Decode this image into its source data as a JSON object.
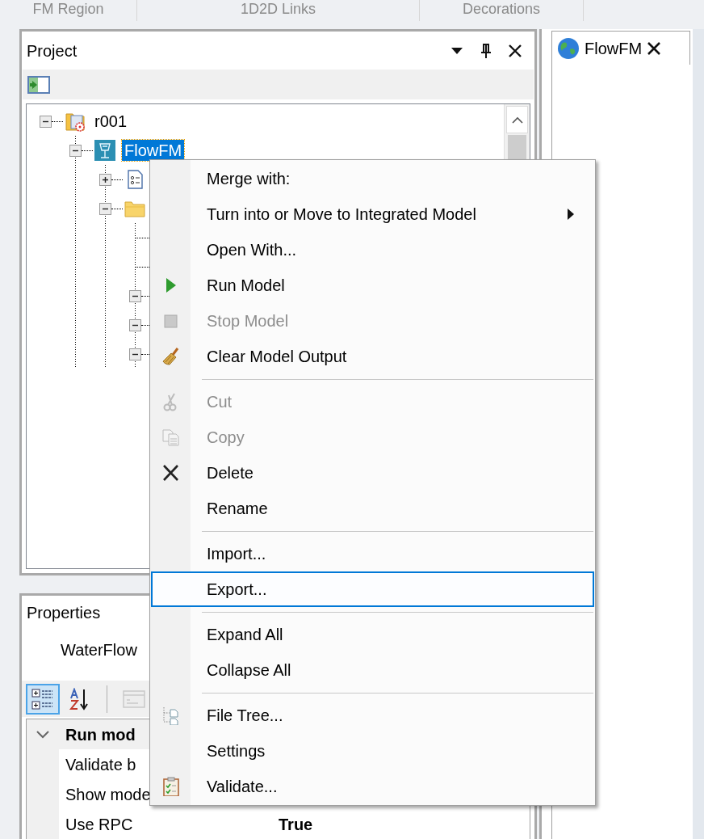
{
  "top_tabs": [
    {
      "label": "FM Region"
    },
    {
      "label": "1D2D Links"
    },
    {
      "label": "Decorations"
    }
  ],
  "project_panel": {
    "title": "Project",
    "tree": [
      {
        "label": "r001",
        "kind": "project",
        "expanded": true,
        "selected": false,
        "children": [
          {
            "label": "FlowFM",
            "kind": "model",
            "expanded": true,
            "selected": true,
            "children": [
              {
                "kind": "settings",
                "expanded": false
              },
              {
                "kind": "folder",
                "expanded": true,
                "children": [
                  {
                    "kind": "leaf"
                  },
                  {
                    "kind": "leaf"
                  },
                  {
                    "kind": "group",
                    "expanded": true
                  },
                  {
                    "kind": "group",
                    "expanded": true
                  },
                  {
                    "kind": "group",
                    "expanded": true
                  }
                ]
              }
            ]
          }
        ]
      }
    ]
  },
  "document_tab": {
    "title": "FlowFM"
  },
  "properties_panel": {
    "title": "Properties",
    "object": "WaterFlow",
    "toolbar": [
      {
        "kind": "categorized",
        "selected": true,
        "disabled": false
      },
      {
        "kind": "alphabetical",
        "selected": false,
        "disabled": false
      },
      {
        "kind": "pages",
        "selected": false,
        "disabled": true
      }
    ],
    "rows": [
      {
        "kind": "category",
        "label": "Run mod",
        "expanded": true
      },
      {
        "kind": "property",
        "label": "Validate b"
      },
      {
        "kind": "property",
        "label": "Show mode"
      },
      {
        "kind": "property",
        "label": "Use RPC",
        "value": "True",
        "modified": true
      }
    ]
  },
  "context_menu": [
    {
      "kind": "command",
      "label": "Merge with:",
      "disabled": false,
      "selected": false
    },
    {
      "kind": "submenu",
      "label": "Turn into or Move to Integrated Model",
      "disabled": false,
      "selected": false
    },
    {
      "kind": "command",
      "label": "Open With...",
      "disabled": false,
      "selected": false
    },
    {
      "kind": "command",
      "label": "Run Model",
      "disabled": false,
      "selected": false
    },
    {
      "kind": "command",
      "label": "Stop Model",
      "disabled": true,
      "selected": false
    },
    {
      "kind": "command",
      "label": "Clear Model Output",
      "disabled": false,
      "selected": false
    },
    {
      "kind": "separator"
    },
    {
      "kind": "command",
      "label": "Cut",
      "disabled": true,
      "selected": false
    },
    {
      "kind": "command",
      "label": "Copy",
      "disabled": true,
      "selected": false
    },
    {
      "kind": "command",
      "label": "Delete",
      "disabled": false,
      "selected": false
    },
    {
      "kind": "command",
      "label": "Rename",
      "disabled": false,
      "selected": false
    },
    {
      "kind": "separator"
    },
    {
      "kind": "command",
      "label": "Import...",
      "disabled": false,
      "selected": false
    },
    {
      "kind": "command",
      "label": "Export...",
      "disabled": false,
      "selected": true
    },
    {
      "kind": "separator"
    },
    {
      "kind": "command",
      "label": "Expand All",
      "disabled": false,
      "selected": false
    },
    {
      "kind": "command",
      "label": "Collapse All",
      "disabled": false,
      "selected": false
    },
    {
      "kind": "separator"
    },
    {
      "kind": "command",
      "label": "File Tree...",
      "disabled": false,
      "selected": false
    },
    {
      "kind": "command",
      "label": "Settings",
      "disabled": false,
      "selected": false
    },
    {
      "kind": "command",
      "label": "Validate...",
      "disabled": false,
      "selected": false
    }
  ]
}
